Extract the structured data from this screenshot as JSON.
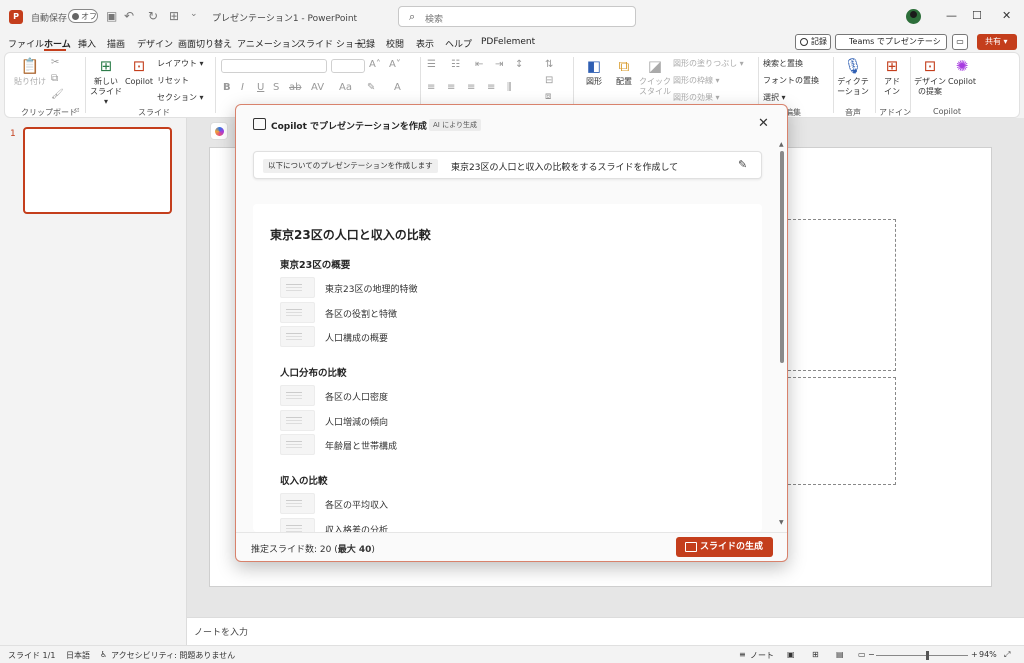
{
  "titlebar": {
    "app_icon": "P",
    "autosave_label": "自動保存",
    "autosave_state": "オフ",
    "doc_title": "プレゼンテーション1 - PowerPoint",
    "search_placeholder": "検索",
    "minimize": "—",
    "maximize": "☐",
    "close": "✕"
  },
  "menu": {
    "tabs": [
      "ファイル",
      "ホーム",
      "挿入",
      "描画",
      "デザイン",
      "画面切り替え",
      "アニメーション",
      "スライド ショー",
      "記録",
      "校閲",
      "表示",
      "ヘルプ",
      "PDFelement"
    ],
    "active_index": 1,
    "record_label": "記録",
    "teams_label": "Teams でプレゼンテーション",
    "share_label": "共有 ▾"
  },
  "ribbon": {
    "paste": "貼り付け",
    "clipboard_group": "クリップボード",
    "new_slide": "新しい スライド ▾",
    "copilot": "Copilot",
    "layout": "レイアウト ▾",
    "reset": "リセット",
    "section": "セクション ▾",
    "slides_group": "スライド",
    "shapes": "図形",
    "arrange": "配置",
    "quick_styles": "クイック スタイル",
    "shape_fill": "図形の塗りつぶし ▾",
    "shape_outline": "図形の枠線 ▾",
    "shape_effects": "図形の効果 ▾",
    "find_replace": "検索と置換",
    "font_replace": "フォントの置換",
    "select": "選択 ▾",
    "editing_group": "編集",
    "dictate": "ディクテーション",
    "voice_group": "音声",
    "addins": "アド イン",
    "addins_group": "アドイン",
    "designer": "デザイン の提案",
    "copilot_big": "Copilot",
    "copilot_group": "Copilot"
  },
  "thumbs": {
    "slide_number": "1"
  },
  "notes": {
    "placeholder": "ノートを入力"
  },
  "status": {
    "slide_count": "スライド 1/1",
    "language": "日本語",
    "accessibility": "アクセシビリティ: 問題ありません",
    "notes_btn": "ノート",
    "zoom": "94%"
  },
  "dialog": {
    "title": "Copilot でプレゼンテーションを作成",
    "ai_badge": "AI により生成",
    "prompt_chip": "以下についてのプレゼンテーションを作成します",
    "prompt_text": "東京23区の人口と収入の比較をするスライドを作成して",
    "outline_title": "東京23区の人口と収入の比較",
    "sections": [
      {
        "heading": "東京23区の概要",
        "items": [
          "東京23区の地理的特徴",
          "各区の役割と特徴",
          "人口構成の概要"
        ]
      },
      {
        "heading": "人口分布の比較",
        "items": [
          "各区の人口密度",
          "人口増減の傾向",
          "年齢層と世帯構成"
        ]
      },
      {
        "heading": "収入の比較",
        "items": [
          "各区の平均収入",
          "収入格差の分析"
        ]
      }
    ],
    "estimate_label": "推定スライド数: 20 (",
    "estimate_max": "最大 40",
    "estimate_close": ")",
    "generate_label": "スライドの生成"
  }
}
